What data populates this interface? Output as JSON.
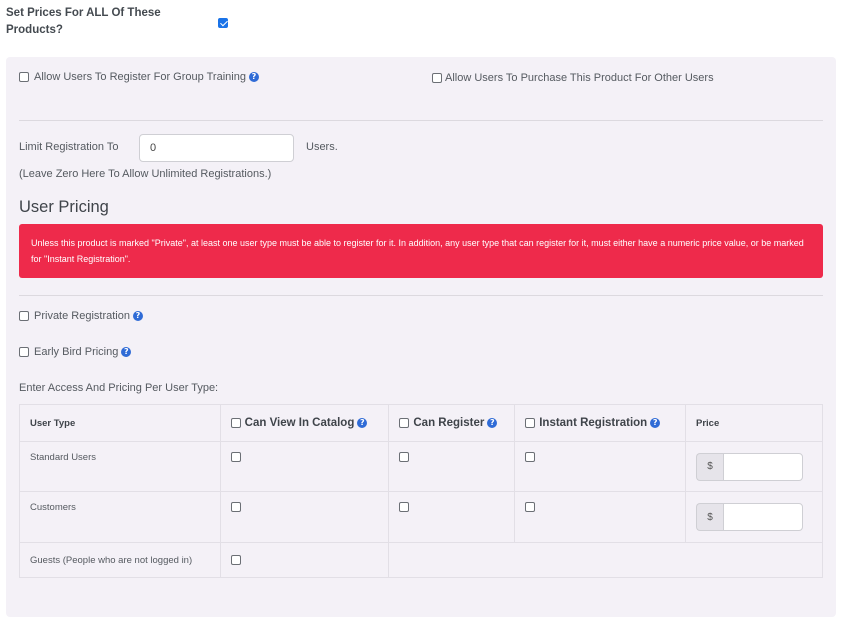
{
  "set_prices": {
    "label": "Set Prices For ALL Of These Products?",
    "checked": true
  },
  "options": {
    "group_training": "Allow Users To Register For Group Training",
    "purchase_for_others": "Allow Users To Purchase This Product For Other Users"
  },
  "limit": {
    "label": "Limit Registration To",
    "value": "0",
    "suffix": "Users.",
    "hint": "(Leave Zero Here To Allow Unlimited Registrations.)"
  },
  "user_pricing": {
    "title": "User Pricing",
    "alert": "Unless this product is marked \"Private\", at least one user type must be able to register for it. In addition, any user type that can register for it, must either have a numeric price value, or be marked for \"Instant Registration\".",
    "private_registration": "Private Registration",
    "early_bird": "Early Bird Pricing",
    "access_label": "Enter Access And Pricing Per User Type:"
  },
  "table": {
    "headers": {
      "user_type": "User Type",
      "can_view": "Can View In Catalog",
      "can_register": "Can Register",
      "instant": "Instant Registration",
      "price": "Price"
    },
    "rows": [
      {
        "name": "Standard Users",
        "currency": "$"
      },
      {
        "name": "Customers",
        "currency": "$"
      },
      {
        "name": "Guests (People who are not logged in)"
      }
    ]
  },
  "icons": {
    "help": "question-circle-icon"
  },
  "colors": {
    "alert_bg": "#ee2a4b",
    "panel_bg": "#f4f1f7",
    "accent": "#1a73e8"
  }
}
